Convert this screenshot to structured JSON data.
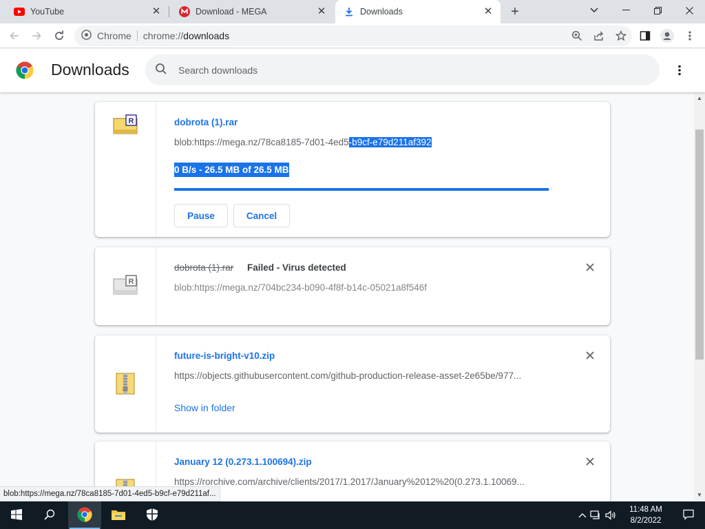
{
  "tabs": [
    {
      "title": "YouTube",
      "icon": "youtube-icon"
    },
    {
      "title": "Download - MEGA",
      "icon": "mega-icon"
    },
    {
      "title": "Downloads",
      "icon": "download-icon",
      "active": true
    }
  ],
  "omnibox": {
    "scheme_label": "Chrome",
    "url_scheme": "chrome://",
    "url_host": "downloads"
  },
  "page": {
    "title": "Downloads",
    "search_placeholder": "Search downloads"
  },
  "downloads": [
    {
      "filename": "dobrota (1).rar",
      "url_plain": "blob:https://mega.nz/78ca8185-7d01-4ed5",
      "url_selected": "-b9cf-e79d211af392",
      "progress_text": "0 B/s - 26.5 MB of 26.5 MB",
      "progress_fraction": 0.99,
      "pause_label": "Pause",
      "cancel_label": "Cancel"
    },
    {
      "filename": "dobrota (1).rar",
      "status": "Failed - Virus detected",
      "url": "blob:https://mega.nz/704bc234-b090-4f8f-b14c-05021a8f546f"
    },
    {
      "filename": "future-is-bright-v10.zip",
      "url": "https://objects.githubusercontent.com/github-production-release-asset-2e65be/977...",
      "show_in_folder": "Show in folder"
    },
    {
      "filename": "January 12 (0.273.1.100694).zip",
      "url": "https://rorchive.com/archive/clients/2017/1.2017/January%2012%20(0.273.1.10069..."
    }
  ],
  "status_bubble": "blob:https://mega.nz/78ca8185-7d01-4ed5-b9cf-e79d211af...",
  "taskbar": {
    "time": "11:48 AM",
    "date": "8/2/2022"
  },
  "colors": {
    "accent": "#1a73e8",
    "taskbar": "#101b24"
  }
}
